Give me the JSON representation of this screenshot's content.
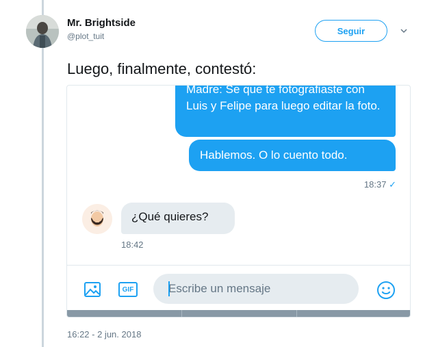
{
  "author": {
    "display_name": "Mr. Brightside",
    "handle": "@plot_tuit",
    "avatar_icon": "user-photo-avatar"
  },
  "follow_button": {
    "label": "Seguir"
  },
  "caret_icon": "chevron-down-icon",
  "tweet": {
    "text": "Luego, finalmente, contestó:",
    "timestamp": "16:22 - 2 jun. 2018"
  },
  "chat": {
    "outgoing": [
      {
        "text": "Madre: Se que te fotografiaste con Luis y Felipe para luego editar la foto."
      },
      {
        "text": "Hablemos. O lo cuento todo."
      }
    ],
    "outgoing_time": "18:37",
    "read_mark": "✓",
    "incoming": {
      "text": "¿Qué quieres?",
      "time": "18:42",
      "avatar_icon": "bearded-man-avatar"
    },
    "composer": {
      "placeholder": "Escribe un mensaje",
      "gif_label": "GIF",
      "image_icon": "image-icon",
      "emoji_icon": "emoji-icon"
    }
  },
  "colors": {
    "accent": "#1da1f2",
    "bubble_in": "#e6ecf0",
    "muted": "#657786"
  }
}
